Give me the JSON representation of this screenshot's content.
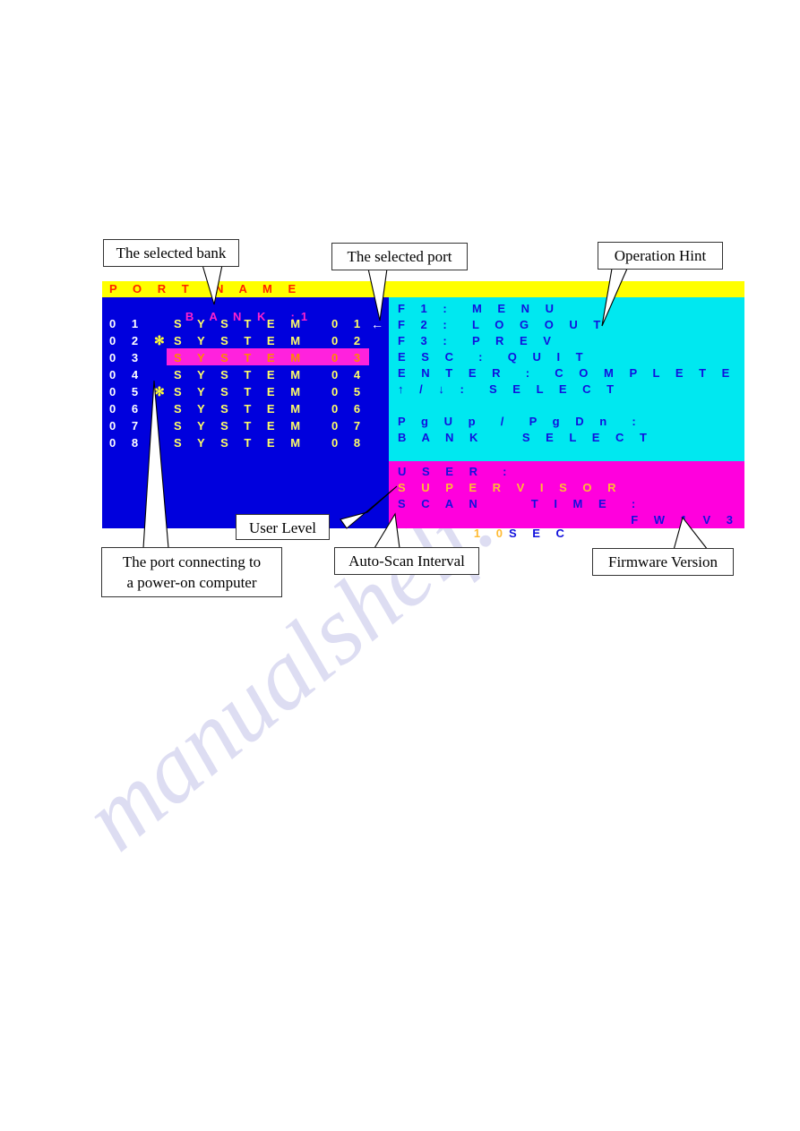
{
  "page": {
    "watermark": "manualshelf.com"
  },
  "osd": {
    "header": {
      "port": "P O R T",
      "name": "N A M E"
    },
    "bank": {
      "label": "B A N K  :",
      "value": "1"
    },
    "selection_arrow": "←",
    "ports": [
      {
        "num": "0 1",
        "star": "",
        "name": "S Y S T E M",
        "index": "0 1",
        "selected": false
      },
      {
        "num": "0 2",
        "star": "✻",
        "name": "S Y S T E M",
        "index": "0 2",
        "selected": false
      },
      {
        "num": "0 3",
        "star": "",
        "name": "S Y S T E M",
        "index": "0 3",
        "selected": true
      },
      {
        "num": "0 4",
        "star": "",
        "name": "S Y S T E M",
        "index": "0 4",
        "selected": false
      },
      {
        "num": "0 5",
        "star": "✻",
        "name": "S Y S T E M",
        "index": "0 5",
        "selected": false
      },
      {
        "num": "0 6",
        "star": "",
        "name": "S Y S T E M",
        "index": "0 6",
        "selected": false
      },
      {
        "num": "0 7",
        "star": "",
        "name": "S Y S T E M",
        "index": "0 7",
        "selected": false
      },
      {
        "num": "0 8",
        "star": "",
        "name": "S Y S T E M",
        "index": "0 8",
        "selected": false
      }
    ],
    "hints": [
      "F 1 :  M E N U",
      "F 2 :  L O G O U T",
      "F 3 :  P R E V",
      "E S C  :  Q U I T",
      "E N T E R  :  C O M P L E T E",
      "↑ / ↓ :  S E L E C T",
      "",
      "P g U p  /  P g D n  :",
      "B A N K    S E L E C T"
    ],
    "status": {
      "user_label": "U S E R  :",
      "user_value": "S U P E R V I S O R",
      "scan_label": "S C A N     T I M E  :",
      "scan_number": "1 0",
      "scan_unit": "S E C",
      "firmware": "F W 1 V 3"
    }
  },
  "colors": {
    "header_bg": "#ffff00",
    "header_text": "#ff2200",
    "list_bg": "#0000dd",
    "hint_bg": "#00e8f0",
    "status_bg": "#ff00dd",
    "hint_text": "#1111dd",
    "name_text": "#ffff66",
    "bank_text": "#ff22cc",
    "highlight_bg": "#ff22dd",
    "highlight_text": "#ff8800",
    "accent_text": "#ffbb33"
  },
  "callouts": [
    {
      "id": "selected-bank",
      "text": "The selected bank"
    },
    {
      "id": "selected-port",
      "text": "The selected port"
    },
    {
      "id": "operation-hint",
      "text": "Operation Hint"
    },
    {
      "id": "user-level",
      "text": "User Level"
    },
    {
      "id": "power-on-port",
      "line1": "The port connecting to",
      "line2": "a power-on computer"
    },
    {
      "id": "auto-scan",
      "text": "Auto-Scan Interval"
    },
    {
      "id": "firmware",
      "text": "Firmware Version"
    }
  ]
}
